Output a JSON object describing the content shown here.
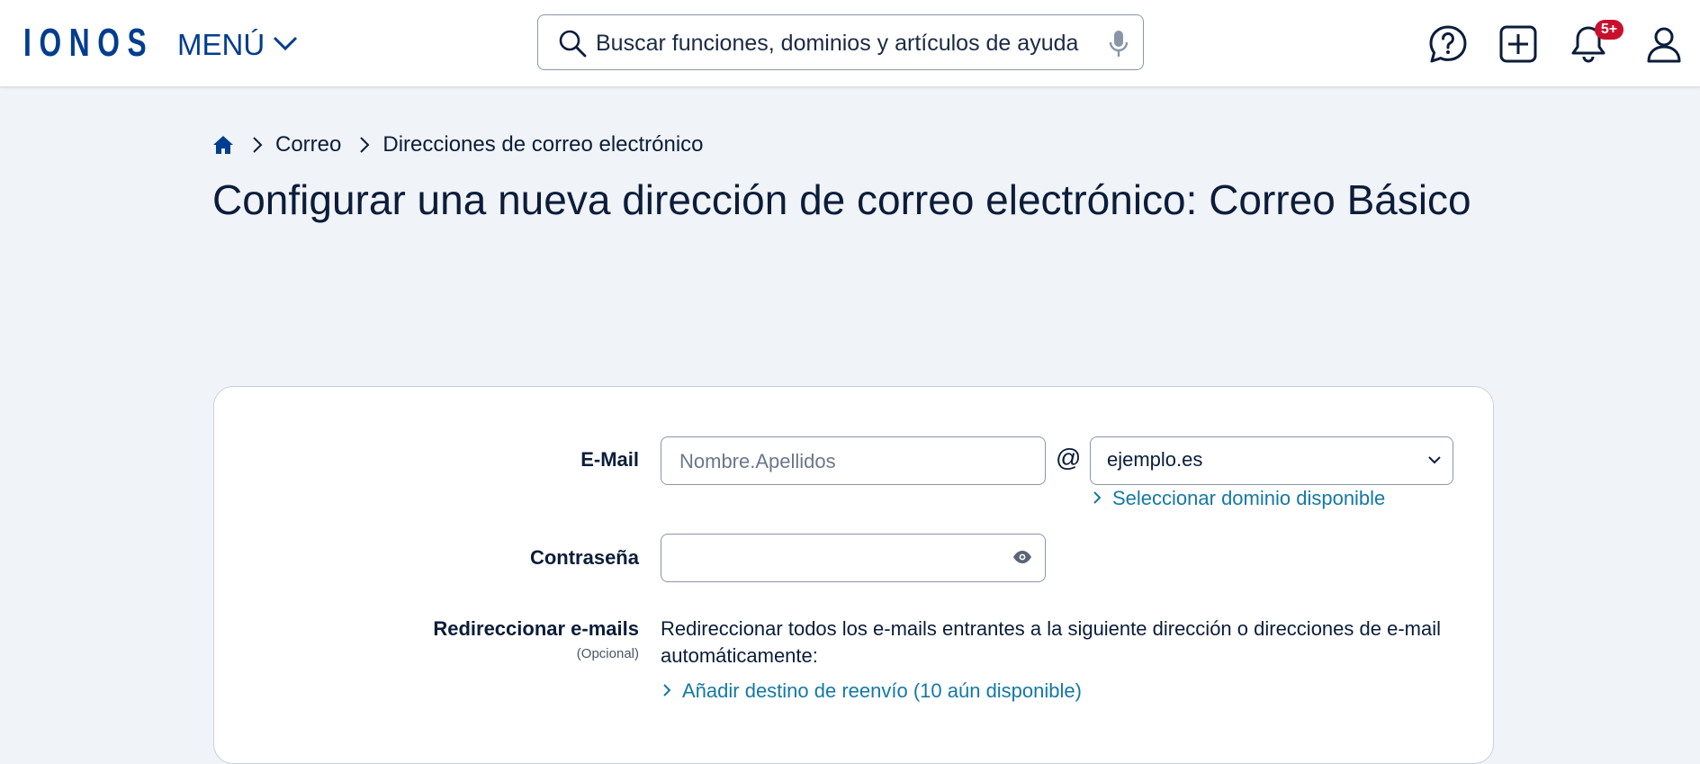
{
  "header": {
    "logo_text": "IONOS",
    "menu_label": "MENÚ",
    "search_placeholder": "Buscar funciones, dominios y artículos de ayuda",
    "notification_badge": "5+",
    "icons": [
      "help-chat-icon",
      "add-icon",
      "bell-icon",
      "user-icon"
    ]
  },
  "breadcrumb": {
    "items": [
      "Correo",
      "Direcciones de correo electrónico"
    ]
  },
  "page": {
    "title": "Configurar una nueva dirección de correo electrónico: Correo Básico"
  },
  "form": {
    "email_label": "E-Mail",
    "email_placeholder": "Nombre.Apellidos",
    "at_symbol": "@",
    "domain_value": "ejemplo.es",
    "select_domain_link": "Seleccionar dominio disponible",
    "password_label": "Contraseña",
    "redirect_label": "Redireccionar e-mails",
    "redirect_optional": "(Opcional)",
    "redirect_description": "Redireccionar todos los e-mails entrantes a la siguiente dirección o direcciones de e-mail automáticamente:",
    "add_forward_link": "Añadir destino de reenvío (10 aún disponible)"
  },
  "colors": {
    "brand": "#003d8f",
    "link": "#1478a6",
    "badge": "#c8102e",
    "background": "#f0f3f7"
  }
}
